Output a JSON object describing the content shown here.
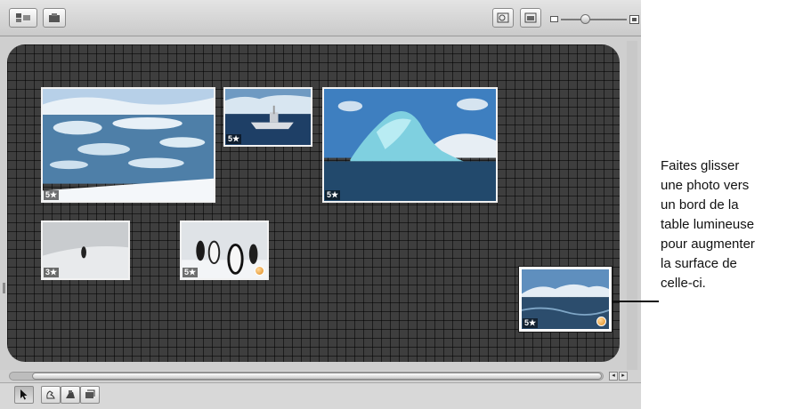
{
  "photos": [
    {
      "id": "glacier-bay",
      "rating": "5★",
      "has_badge": false
    },
    {
      "id": "ship",
      "rating": "5★",
      "has_badge": false
    },
    {
      "id": "iceberg",
      "rating": "5★",
      "has_badge": false
    },
    {
      "id": "lone-penguin",
      "rating": "3★",
      "has_badge": false
    },
    {
      "id": "penguins",
      "rating": "5★",
      "has_badge": true
    },
    {
      "id": "stormy-sea",
      "rating": "5★",
      "has_badge": true
    }
  ],
  "callout": {
    "lines": [
      "Faites glisser",
      "une photo vers",
      "un bord de la",
      "table lumineuse",
      "pour augmenter",
      "la surface de",
      "celle-ci."
    ]
  },
  "colors": {
    "table_bg": "#3e3e3e",
    "badge_orange": "#e08a1c"
  }
}
